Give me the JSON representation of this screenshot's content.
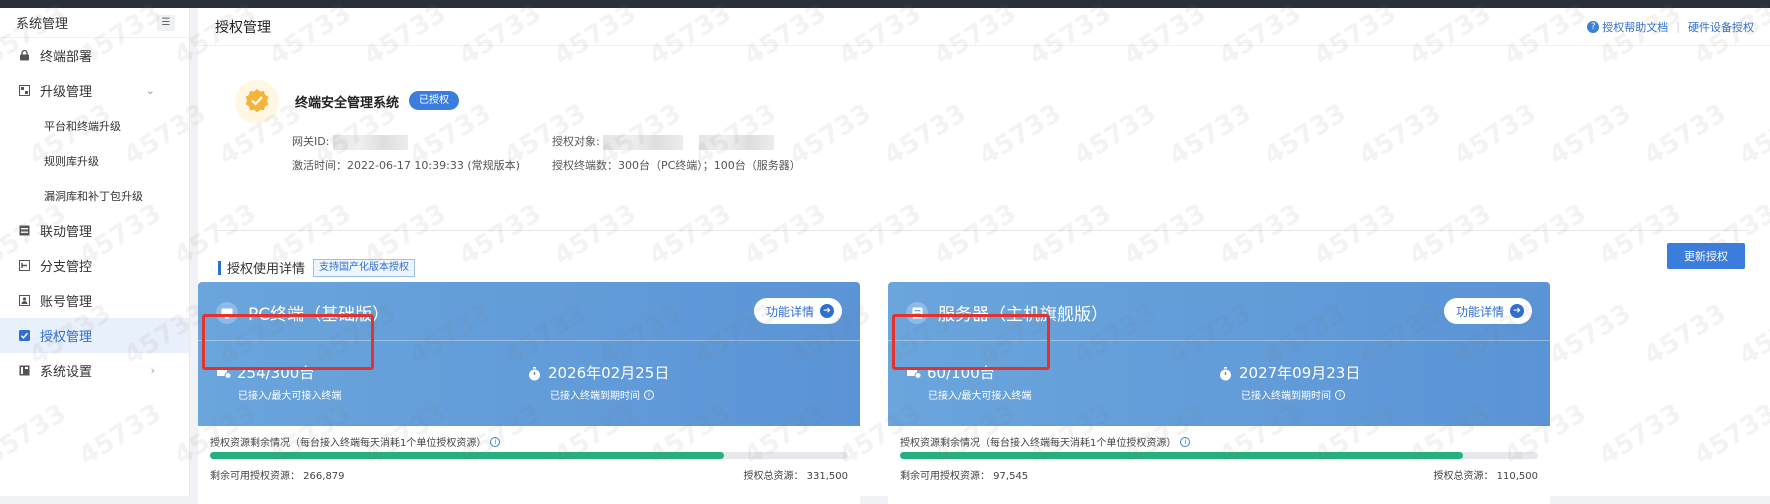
{
  "sidebar": {
    "title": "系统管理",
    "items": [
      {
        "label": "终端部署"
      },
      {
        "label": "升级管理"
      },
      {
        "label": "平台和终端升级"
      },
      {
        "label": "规则库升级"
      },
      {
        "label": "漏洞库和补丁包升级"
      },
      {
        "label": "联动管理"
      },
      {
        "label": "分支管控"
      },
      {
        "label": "账号管理"
      },
      {
        "label": "授权管理"
      },
      {
        "label": "系统设置"
      }
    ]
  },
  "header": {
    "title": "授权管理",
    "help_link": "授权帮助文档",
    "hardware_link": "硬件设备授权"
  },
  "product": {
    "name": "终端安全管理系统",
    "status": "已授权",
    "gateway_label": "网关ID:",
    "target_label": "授权对象:",
    "activation": "激活时间：2022-06-17 10:39:33 (常规版本)",
    "terminals": "授权终端数：300台（PC终端）；100台（服务器）"
  },
  "usage": {
    "title": "授权使用详情",
    "tag": "支持国产化版本授权",
    "update_button": "更新授权"
  },
  "cards": [
    {
      "title": "PC终端（基础版）",
      "func_button": "功能详情",
      "count": "254/300台",
      "count_label": "已接入/最大可接入终端",
      "expiry": "2026年02月25日",
      "expiry_label": "已接入终端到期时间",
      "resource_title": "授权资源剩余情况（每台接入终端每天消耗1个单位授权资源）",
      "remaining": "剩余可用授权资源： 266,879",
      "total": "授权总资源： 331,500",
      "progress": 0.805
    },
    {
      "title": "服务器（主机旗舰版）",
      "func_button": "功能详情",
      "count": "60/100台",
      "count_label": "已接入/最大可接入终端",
      "expiry": "2027年09月23日",
      "expiry_label": "已接入终端到期时间",
      "resource_title": "授权资源剩余情况（每台接入终端每天消耗1个单位授权资源）",
      "remaining": "剩余可用授权资源： 97,545",
      "total": "授权总资源： 110,500",
      "progress": 0.883
    }
  ],
  "watermark": "45733",
  "colors": {
    "accent": "#2f6fd1",
    "card": "#6aa5dc",
    "progress": "#26b07e",
    "highlight": "#e5312b"
  }
}
